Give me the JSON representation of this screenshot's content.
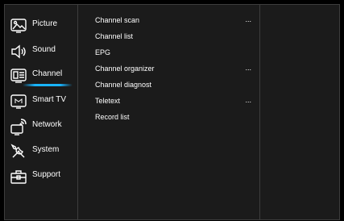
{
  "sidebar": {
    "items": [
      {
        "label": "Picture",
        "icon": "picture-icon"
      },
      {
        "label": "Sound",
        "icon": "speaker-icon"
      },
      {
        "label": "Channel",
        "icon": "channel-icon",
        "selected": true
      },
      {
        "label": "Smart TV",
        "icon": "smart-tv-icon"
      },
      {
        "label": "Network",
        "icon": "network-icon"
      },
      {
        "label": "System",
        "icon": "tools-icon"
      },
      {
        "label": "Support",
        "icon": "toolbox-icon"
      }
    ]
  },
  "submenu": {
    "items": [
      {
        "label": "Channel scan",
        "more": "..."
      },
      {
        "label": "Channel list",
        "more": ""
      },
      {
        "label": "EPG",
        "more": ""
      },
      {
        "label": "Channel organizer",
        "more": "..."
      },
      {
        "label": "Channel diagnost",
        "more": ""
      },
      {
        "label": "Teletext",
        "more": "..."
      },
      {
        "label": "Record list",
        "more": ""
      }
    ]
  },
  "colors": {
    "accent": "#19b4ff",
    "panel": "#1b1b1b",
    "border": "#3d3d3d"
  }
}
